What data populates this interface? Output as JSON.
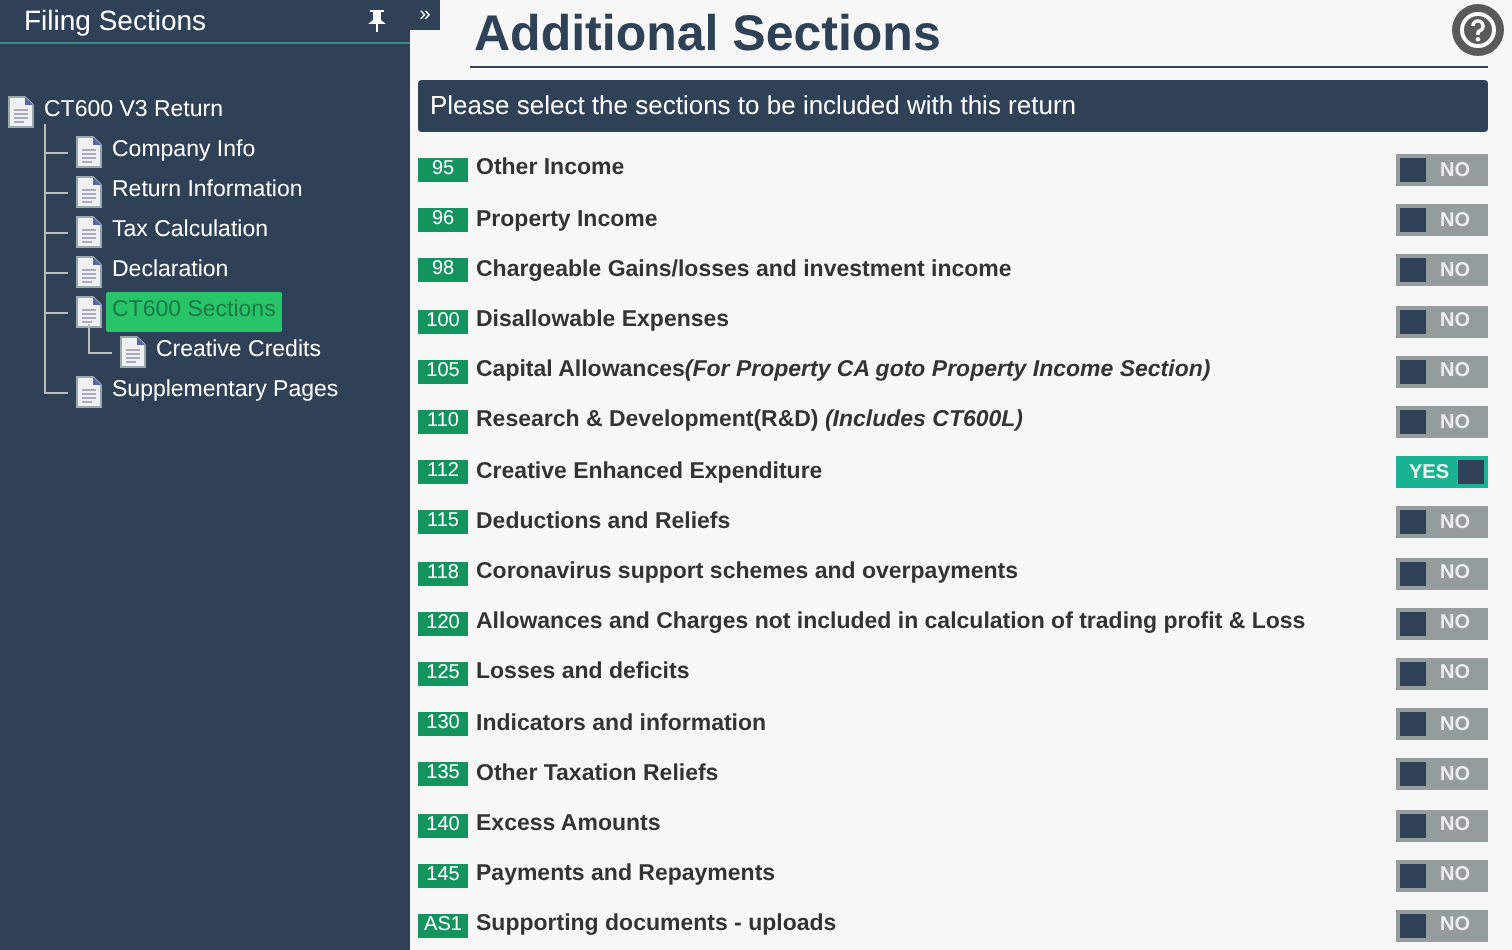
{
  "sidebar": {
    "title": "Filing Sections",
    "tree": [
      {
        "label": "CT600 V3 Return",
        "selected": false,
        "children": [
          {
            "label": "Company Info",
            "selected": false
          },
          {
            "label": "Return Information",
            "selected": false
          },
          {
            "label": "Tax Calculation",
            "selected": false
          },
          {
            "label": "Declaration",
            "selected": false
          },
          {
            "label": "CT600 Sections",
            "selected": true,
            "children": [
              {
                "label": "Creative Credits",
                "selected": false
              }
            ]
          },
          {
            "label": "Supplementary Pages",
            "selected": false
          }
        ]
      }
    ]
  },
  "collapse_button": "»",
  "main": {
    "title": "Additional Sections",
    "banner": "Please select the sections to be included with this return",
    "sections": [
      {
        "code": "95",
        "label": "Other Income",
        "on": false,
        "toggle_text": "NO"
      },
      {
        "code": "96",
        "label": "Property Income",
        "on": false,
        "toggle_text": "NO"
      },
      {
        "code": "98",
        "label": "Chargeable Gains/losses and investment income",
        "on": false,
        "toggle_text": "NO"
      },
      {
        "code": "100",
        "label": "Disallowable Expenses",
        "on": false,
        "toggle_text": "NO"
      },
      {
        "code": "105",
        "label": "Capital Allowances",
        "note": "(For Property CA goto Property Income Section)",
        "on": false,
        "toggle_text": "NO"
      },
      {
        "code": "110",
        "label": "Research & Development(R&D) *(Includes CT600L)*",
        "on": false,
        "toggle_text": "NO"
      },
      {
        "code": "112",
        "label": "Creative Enhanced Expenditure",
        "on": true,
        "toggle_text": "YES"
      },
      {
        "code": "115",
        "label": "Deductions and Reliefs",
        "on": false,
        "toggle_text": "NO"
      },
      {
        "code": "118",
        "label": "Coronavirus support schemes and overpayments",
        "on": false,
        "toggle_text": "NO"
      },
      {
        "code": "120",
        "label": "Allowances and Charges not included in calculation of trading profit & Loss",
        "on": false,
        "toggle_text": "NO"
      },
      {
        "code": "125",
        "label": "Losses and deficits",
        "on": false,
        "toggle_text": "NO"
      },
      {
        "code": "130",
        "label": "Indicators and information",
        "on": false,
        "toggle_text": "NO"
      },
      {
        "code": "135",
        "label": "Other Taxation Reliefs",
        "on": false,
        "toggle_text": "NO"
      },
      {
        "code": "140",
        "label": "Excess Amounts",
        "on": false,
        "toggle_text": "NO"
      },
      {
        "code": "145",
        "label": "Payments and Repayments",
        "on": false,
        "toggle_text": "NO"
      },
      {
        "code": "AS1",
        "label": "Supporting documents - uploads",
        "on": false,
        "toggle_text": "NO"
      }
    ]
  }
}
